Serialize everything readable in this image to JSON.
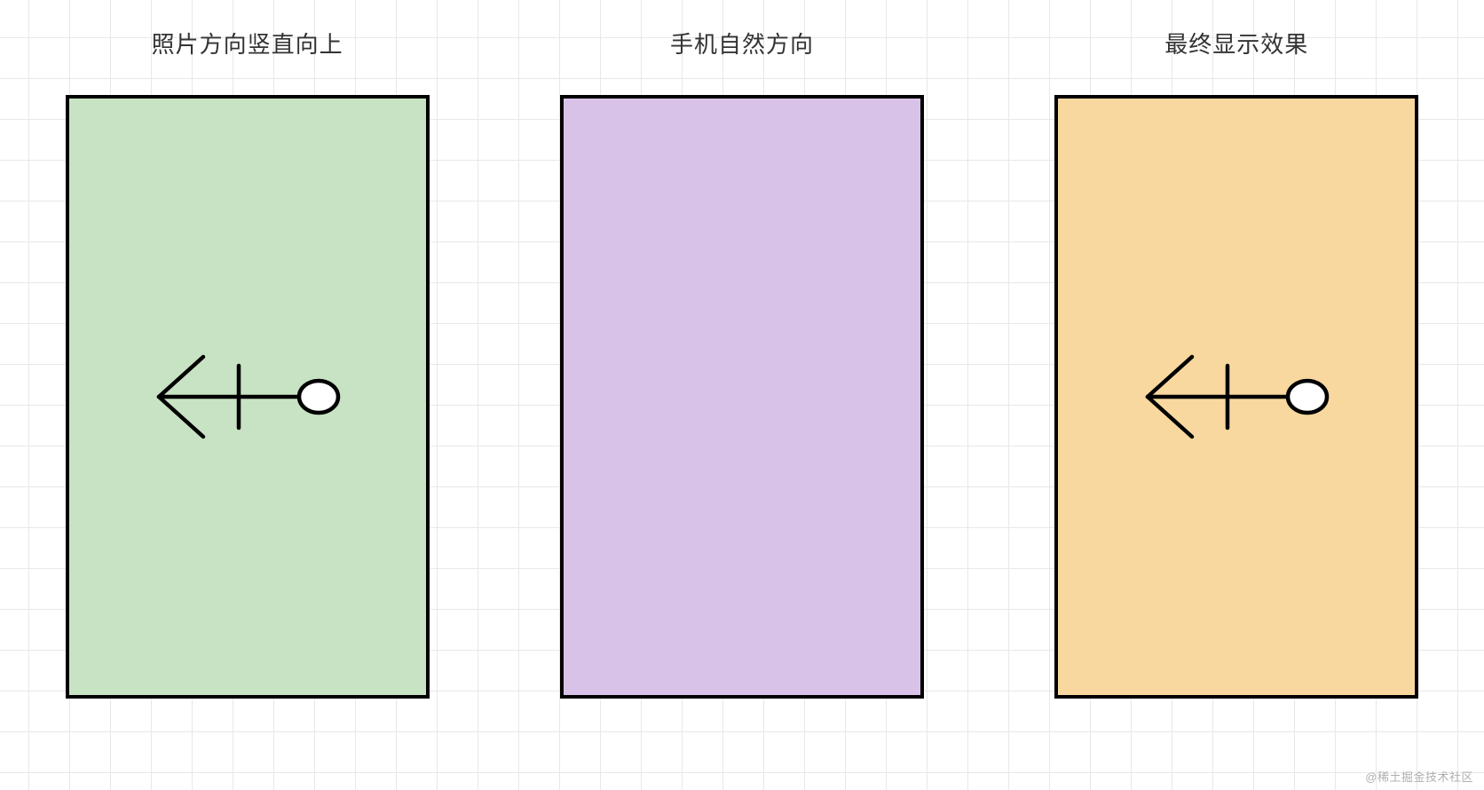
{
  "panels": [
    {
      "title": "照片方向竖直向上",
      "color": "green",
      "hasFigure": true
    },
    {
      "title": "手机自然方向",
      "color": "purple",
      "hasFigure": false
    },
    {
      "title": "最终显示效果",
      "color": "orange",
      "hasFigure": true
    }
  ],
  "colors": {
    "green": "#c8e3c3",
    "purple": "#d9c2e8",
    "orange": "#f8d89f",
    "border": "#000000",
    "grid": "#e8e8e8"
  },
  "watermark": "@稀土掘金技术社区"
}
